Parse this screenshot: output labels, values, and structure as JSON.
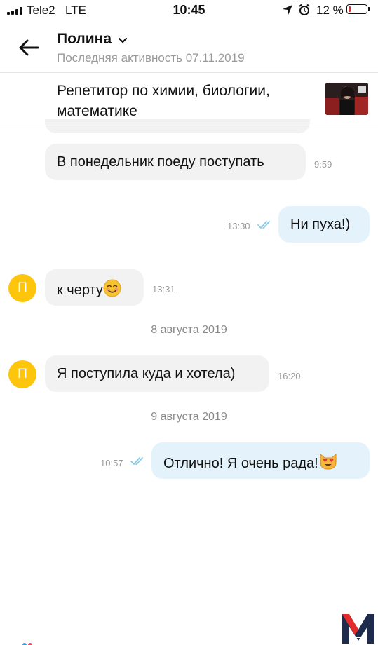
{
  "status_bar": {
    "carrier": "Tele2",
    "network": "LTE",
    "time": "10:45",
    "battery_percent": "12 %",
    "battery_level": 0.12,
    "icons": [
      "signal-icon",
      "location-arrow-icon",
      "alarm-icon",
      "battery-icon"
    ]
  },
  "header": {
    "name": "Полина",
    "last_seen": "Последняя активность 07.11.2019"
  },
  "listing": {
    "title": "Репетитор по химии, биологии, математике"
  },
  "messages": [
    {
      "direction": "in",
      "text": "В понедельник поеду поступать",
      "time": "9:59"
    },
    {
      "direction": "out",
      "text": "Ни пуха!)",
      "time": "13:30",
      "read": true
    },
    {
      "direction": "in",
      "text": "к черту",
      "emoji": "smiling-face-icon",
      "time": "13:31",
      "avatar_letter": "П"
    },
    {
      "date_separator": "8 августа 2019"
    },
    {
      "direction": "in",
      "text": "Я поступила куда и хотела)",
      "time": "16:20",
      "avatar_letter": "П"
    },
    {
      "date_separator": "9 августа 2019"
    },
    {
      "direction": "out",
      "text": "Отлично! Я очень рада!",
      "emoji": "heart-eyes-cat-icon",
      "time": "10:57",
      "read": true
    }
  ],
  "colors": {
    "incoming_bubble": "#f2f2f2",
    "outgoing_bubble": "#e4f3fb",
    "avatar": "#fdc60d",
    "read_ticks": "#8ccbe8",
    "battery_low": "#e32b2b"
  }
}
